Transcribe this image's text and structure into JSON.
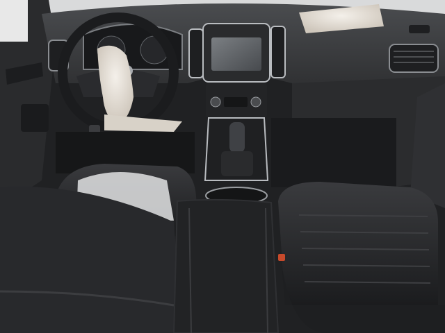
{
  "scene": {
    "subject": "car-interior-front-cabin",
    "colors": {
      "dashboard": "#3a3b3d",
      "seat_leather": "#26272a",
      "airbag_fabric": "#e6e1da",
      "chrome_trim": "#b9bcc0",
      "screen": "#5b5f63",
      "light_background": "#f2f2f2"
    },
    "icons": [
      "steering-wheel-icon",
      "gear-shifter-icon",
      "airbag-icon",
      "infotainment-screen-icon",
      "air-vent-icon",
      "seat-icon"
    ]
  }
}
